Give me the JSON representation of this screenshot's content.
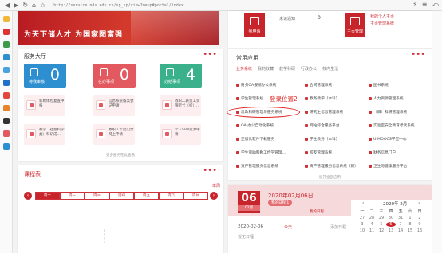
{
  "browser": {
    "url": "http://service.ndu.edu.cn/sp_sp/view?m=up#portal/index",
    "nav": [
      "◀",
      "▶",
      "↻",
      "⌂",
      "☆"
    ],
    "right_tools": [
      "⚡",
      "≡",
      "⤺"
    ]
  },
  "banner": {
    "slogan": "为天下储人才  为国家图富强"
  },
  "notice": {
    "tiles": [
      {
        "label": "我申请"
      },
      {
        "label": "主页管理"
      }
    ],
    "unread_label": "未读通知",
    "unread_count": "0",
    "links": [
      "我的个人主页",
      "主页管理系统"
    ]
  },
  "service": {
    "title": "服务大厅",
    "more": "•••",
    "tiles": [
      {
        "label": "待我审核",
        "count": "0",
        "color": "#2e8fd0"
      },
      {
        "label": "在办事项",
        "count": "0",
        "color": "#e25a5f"
      },
      {
        "label": "办结事项",
        "count": "4",
        "color": "#3bb18b"
      }
    ],
    "items": [
      "新聘体检复查申报",
      "信息系统备案登记申请",
      "教职工薪资工资银行卡（折）…",
      "教学（社会科学类）科研成…",
      "教职工年度门禁网上申请",
      "个人VPN资源申请"
    ],
    "more_link": "更多服务在此查看"
  },
  "apps": {
    "title": "常用应用",
    "more": "•••",
    "tabs": [
      "业务系统",
      "我的收藏",
      "教学科研",
      "行政办公",
      "校内生活"
    ],
    "items": [
      [
        "财务OA报销办公系统",
        "合同管理系统",
        "图书系统"
      ],
      [
        "学生管理系统",
        "教务教学（本科）",
        "人力资源管理系统"
      ],
      [
        "思政科研管理与服务系统",
        "研究生信息管理系统",
        "（旧）科研管理系统"
      ],
      [
        "OA 办公自动化系统",
        "网站综合服务平台",
        "实验室安全教育考试系统"
      ],
      [
        "正版化软件下载服务",
        "学生教务（本科）",
        "U-MOOCS学堂中心"
      ],
      [
        "学生资助和勤工俭学管理…",
        "校友管理系统",
        "财务信息门户"
      ],
      [
        "资产管理服务信息系统",
        "资产管理服务信息系统（新）",
        "卫生与健康服务平台"
      ]
    ],
    "annotation": "登录位置2",
    "more_link": "展开全部应用"
  },
  "course": {
    "title": "课程表",
    "more": "•••",
    "this_week": "本周",
    "weeks": [
      "周一",
      "周二",
      "周三",
      "周四",
      "周五",
      "周六",
      "周日"
    ],
    "prev": "‹",
    "next": "›"
  },
  "calendar": {
    "day": "06",
    "month_label": "02月",
    "event_date": "2020年02月06日",
    "event_badge": "我的日程 1",
    "event_tag": "我的日程",
    "list_date": "2020-02-06",
    "today_label": "今天",
    "add_label": "添加日程",
    "no_event": "暂无日程",
    "mini_title": "2020年 2月",
    "weekday_heads": [
      "一",
      "二",
      "三",
      "四",
      "五",
      "六",
      "日"
    ],
    "mini_days": [
      "27",
      "28",
      "29",
      "30",
      "31",
      "1",
      "2",
      "3",
      "4",
      "5",
      "6",
      "7",
      "8",
      "9",
      "10",
      "11",
      "12",
      "13",
      "14",
      "15",
      "16"
    ],
    "selected_day": "6",
    "colors": {
      "accent": "#c8242b",
      "light": "#f6dadb"
    }
  }
}
